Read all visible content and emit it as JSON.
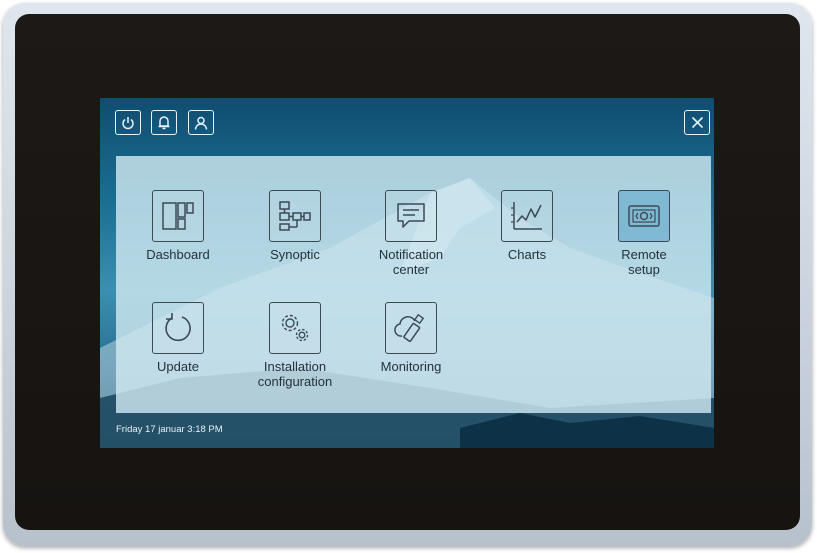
{
  "topbar": {
    "power_icon": "power-icon",
    "bell_icon": "bell-icon",
    "user_icon": "user-icon",
    "close_icon": "close-icon"
  },
  "apps": [
    {
      "label": "Dashboard",
      "icon": "dashboard-icon"
    },
    {
      "label": "Synoptic",
      "icon": "synoptic-icon"
    },
    {
      "label": "Notification\ncenter",
      "icon": "notification-icon"
    },
    {
      "label": "Charts",
      "icon": "charts-icon"
    },
    {
      "label": "Remote\nsetup",
      "icon": "remote-setup-icon",
      "selected": true
    },
    {
      "label": "Update",
      "icon": "update-icon"
    },
    {
      "label": "Installation\nconfiguration",
      "icon": "gears-icon"
    },
    {
      "label": "Monitoring",
      "icon": "cloud-usb-icon"
    }
  ],
  "status_bar": {
    "datetime": "Friday 17 januar 3:18 PM"
  },
  "colors": {
    "bezel": "#1b1714",
    "frame": "#cfd8e1",
    "screen_bg": "#1b6f93",
    "panel": "#d0e8f0",
    "icon_stroke": "#3b4a55",
    "selected_icon_bg": "#7fb9d3"
  }
}
